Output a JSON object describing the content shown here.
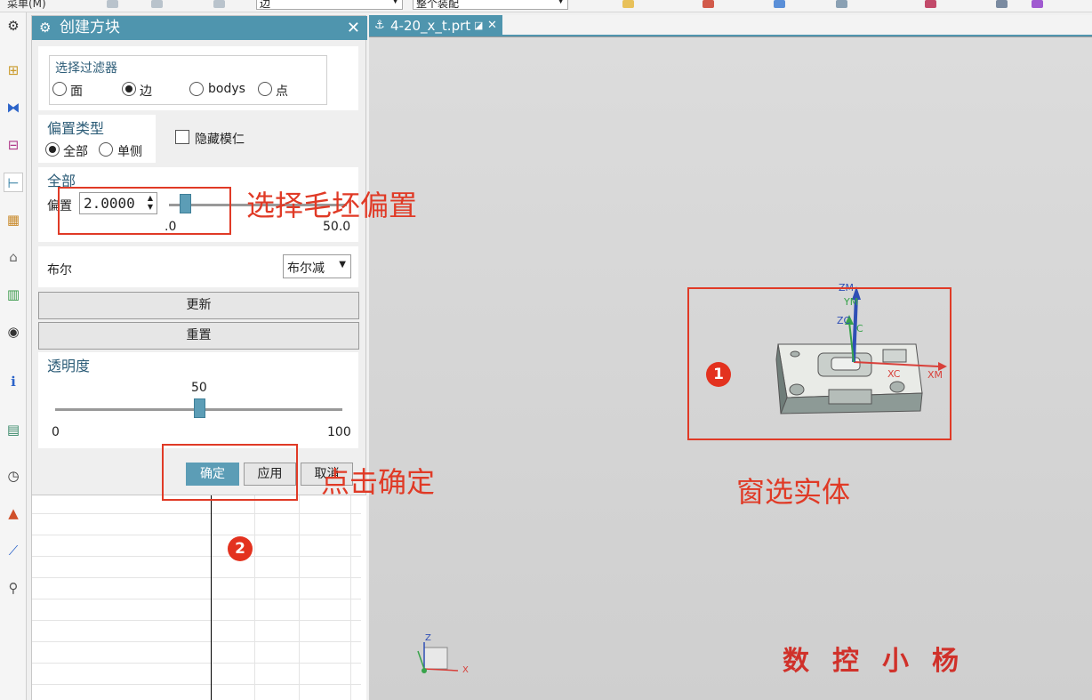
{
  "topbar": {
    "menu": "菜单(M)",
    "filter_select": "边",
    "assembly_select": "整个装配"
  },
  "dialog": {
    "title": "创建方块",
    "filter": {
      "title": "选择过滤器",
      "options": [
        "面",
        "边",
        "bodys",
        "点"
      ],
      "selected": "边"
    },
    "offset_type": {
      "title": "偏置类型",
      "options": [
        "全部",
        "单侧"
      ],
      "selected": "全部"
    },
    "hide_core": {
      "label": "隐藏模仁",
      "checked": false
    },
    "all": {
      "title": "全部",
      "offset_label": "偏置",
      "offset_value": "2.0000",
      "slider_min": ".0",
      "slider_max": "50.0",
      "slider_fraction": 0.04
    },
    "boolean": {
      "label": "布尔",
      "value": "布尔减"
    },
    "update_button": "更新",
    "reset_button": "重置",
    "transparency": {
      "title": "透明度",
      "value": "50",
      "min": "0",
      "max": "100",
      "fraction": 0.5
    },
    "ok_button": "确定",
    "apply_button": "应用",
    "cancel_button": "取消"
  },
  "graphics": {
    "tab_title": "4-20_x_t.prt",
    "axes": {
      "zm": "ZM",
      "ym": "YM",
      "zc": "ZC",
      "yc": "C",
      "xc": "XC",
      "xm": "XM"
    },
    "triad": {
      "z": "Z",
      "x": "X"
    }
  },
  "annotations": {
    "select_offset": "选择毛坯偏置",
    "click_ok": "点击确定",
    "window_select": "窗选实体",
    "badge1": "1",
    "badge2": "2",
    "watermark": "数控小杨"
  },
  "colors": {
    "accent": "#4f95ae",
    "annotation_red": "#e03a26",
    "axis_red": "#d8403a",
    "axis_blue": "#2f4fb5",
    "axis_green": "#37a34a"
  }
}
